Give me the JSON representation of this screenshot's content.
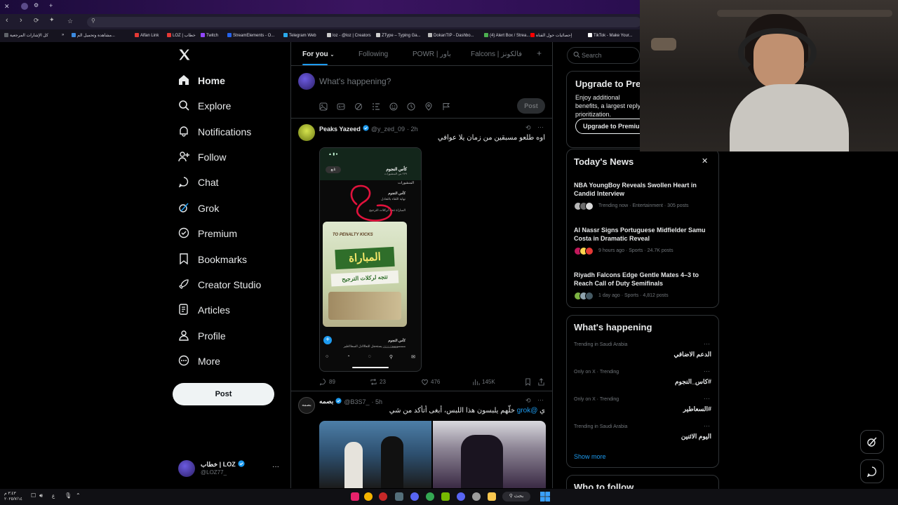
{
  "browser": {
    "bookmarks": [
      {
        "label": "كل الإشارات المرجعية",
        "color": "#5f6368"
      },
      {
        "label": "مشاهدة وتحميل الم...",
        "color": "#3c8be0"
      },
      {
        "label": "Alfan Link",
        "color": "#e53935"
      },
      {
        "label": "LOZ | خطاب",
        "color": "#e53935"
      },
      {
        "label": "Twitch",
        "color": "#9146ff"
      },
      {
        "label": "StreamElements - O...",
        "color": "#2563eb"
      },
      {
        "label": "Telegram Web",
        "color": "#29a9eb"
      },
      {
        "label": "loz - @loz | Creators",
        "color": "#cccccc"
      },
      {
        "label": "ZType – Typing Ga...",
        "color": "#d0d0d0"
      },
      {
        "label": "DokanTIP - Dashbo...",
        "color": "#bbbbbb"
      },
      {
        "label": "(4) Alert Box / Strea...",
        "color": "#4caf50"
      },
      {
        "label": "إحصائيات حول القناة",
        "color": "#ff0000"
      },
      {
        "label": "TikTok - Make Your...",
        "color": "#ffffff"
      }
    ]
  },
  "nav": {
    "items": [
      {
        "label": "Home",
        "icon": "home-icon"
      },
      {
        "label": "Explore",
        "icon": "search-icon"
      },
      {
        "label": "Notifications",
        "icon": "bell-icon"
      },
      {
        "label": "Follow",
        "icon": "follow-icon"
      },
      {
        "label": "Chat",
        "icon": "chat-icon"
      },
      {
        "label": "Grok",
        "icon": "grok-icon"
      },
      {
        "label": "Premium",
        "icon": "premium-icon"
      },
      {
        "label": "Bookmarks",
        "icon": "bookmark-icon"
      },
      {
        "label": "Creator Studio",
        "icon": "rocket-icon"
      },
      {
        "label": "Articles",
        "icon": "articles-icon"
      },
      {
        "label": "Profile",
        "icon": "profile-icon"
      },
      {
        "label": "More",
        "icon": "more-icon"
      }
    ],
    "post_label": "Post",
    "account": {
      "name": "خطاب | LOZ",
      "handle": "@LOZ77_"
    }
  },
  "tabs": [
    "For you",
    "Following",
    "POWR | باور",
    "Falcons | فالكونز"
  ],
  "compose": {
    "placeholder": "What's happening?",
    "post_label": "Post"
  },
  "tweets": [
    {
      "name": "Peaks Yazeed",
      "handle": "@y_zed_09",
      "time": "· 2h",
      "text": "اوه طلعو مسبقين من زمان يلا عوافي",
      "stats": {
        "replies": "89",
        "retweets": "23",
        "likes": "476",
        "views": "145K"
      },
      "phone_screen": {
        "header": "كأس النجوم",
        "header_sub": "٢٧٩ من المنشورات",
        "tab": "المنشورات",
        "post_name": "كأس النجوم",
        "post_line1": "نهاية اللقاء بالتعادل",
        "post_line2": "المباراة تتجه لركلات الترجيح",
        "card_kicks": "TO PENALTY KICKS",
        "card_big": "المباراة",
        "card_small": "تتجه لركلات الترجيح",
        "bottom_name": "كأس النجوم",
        "bottom_line": "ممممووووزززززز يستحجل التعاااادل السعاااطير",
        "follow_label": "تابع"
      }
    },
    {
      "name": "بصمه",
      "handle": "@B3S7_",
      "time": "· 5h",
      "mention": "@grok",
      "text": "خلّهم يلبسون هذا اللبس، أبغى أتأكد من شي"
    }
  ],
  "search": {
    "placeholder": "Search"
  },
  "premium": {
    "title": "Upgrade to Premium",
    "text": "Enjoy additional benefits, a largest reply prioritization.",
    "button": "Upgrade to Premium"
  },
  "news": {
    "title": "Today's News",
    "items": [
      {
        "title": "NBA YoungBoy Reveals Swollen Heart in Candid Interview",
        "meta": "Trending now · Entertainment · 305 posts",
        "avatars": [
          "#b7b7b7",
          "#6b6b6b",
          "#d9d9d9"
        ]
      },
      {
        "title": "Al Nassr Signs Portuguese Midfielder Samu Costa in Dramatic Reveal",
        "meta": "9 hours ago · Sports · 24.7K posts",
        "avatars": [
          "#c2185b",
          "#ffd54f",
          "#e53935"
        ]
      },
      {
        "title": "Riyadh Falcons Edge Gentle Mates 4–3 to Reach Call of Duty Semifinals",
        "meta": "1 day ago · Sports · 4,812 posts",
        "avatars": [
          "#7cb342",
          "#90a4ae",
          "#455a64"
        ]
      }
    ]
  },
  "happening": {
    "title": "What's happening",
    "trends": [
      {
        "context": "Trending in Saudi Arabia",
        "name": "الدعم الاضافي"
      },
      {
        "context": "Only on X · Trending",
        "name": "#كاس_النجوم"
      },
      {
        "context": "Only on X · Trending",
        "name": "#السعاطير"
      },
      {
        "context": "Trending in Saudi Arabia",
        "name": "اليوم الاثنين"
      }
    ],
    "show_more": "Show more"
  },
  "who_to_follow": {
    "title": "Who to follow"
  },
  "taskbar": {
    "search_label": "بحث",
    "time": "٣:٤٣ م",
    "date": "٢٠٢٥/٧/١٤",
    "lang": "ع"
  },
  "colors": {
    "accent": "#1d9bf0",
    "verified": "#1d9bf0",
    "annotation": "#e0123c"
  }
}
